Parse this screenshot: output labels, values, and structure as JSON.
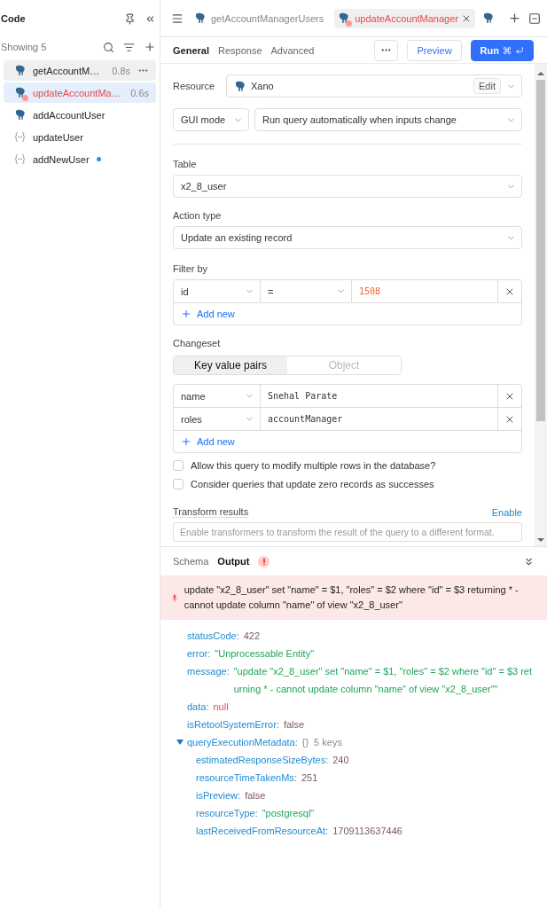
{
  "sidebar": {
    "title": "Code",
    "count_label": "Showing 5",
    "items": [
      {
        "name": "getAccountM…",
        "time": "0.8s",
        "kind": "resource",
        "selected": false,
        "hovered": true,
        "error": false,
        "unsaved": false
      },
      {
        "name": "updateAccountMa…",
        "time": "0.6s",
        "kind": "resource",
        "selected": true,
        "hovered": false,
        "error": true,
        "unsaved": false
      },
      {
        "name": "addAccountUser",
        "kind": "resource",
        "selected": false,
        "hovered": false,
        "error": false,
        "unsaved": false
      },
      {
        "name": "updateUser",
        "kind": "script",
        "selected": false,
        "hovered": false,
        "error": false,
        "unsaved": false
      },
      {
        "name": "addNewUser",
        "kind": "script",
        "selected": false,
        "hovered": false,
        "error": false,
        "unsaved": true
      }
    ]
  },
  "tabs": [
    {
      "label": "getAccountManagerUsers",
      "selected": false,
      "error": false
    },
    {
      "label": "updateAccountManager",
      "selected": true,
      "error": true
    }
  ],
  "subtabs": [
    {
      "label": "General",
      "selected": true
    },
    {
      "label": "Response",
      "selected": false
    },
    {
      "label": "Advanced",
      "selected": false
    }
  ],
  "actions": {
    "preview": "Preview",
    "run": "Run"
  },
  "form": {
    "resource": {
      "label": "Resource",
      "value": "Xano",
      "edit": "Edit"
    },
    "mode": "GUI mode",
    "trigger": "Run query automatically when inputs change",
    "table": {
      "label": "Table",
      "value": "x2_8_user"
    },
    "action_type": {
      "label": "Action type",
      "value": "Update an existing record"
    },
    "filter": {
      "label": "Filter by",
      "rows": [
        {
          "column": "id",
          "operator": "=",
          "value": "1508"
        }
      ],
      "add": "Add new"
    },
    "changeset": {
      "label": "Changeset",
      "modes": [
        {
          "label": "Key value pairs",
          "selected": true
        },
        {
          "label": "Object",
          "selected": false
        }
      ],
      "rows": [
        {
          "key": "name",
          "value": "Snehal Parate"
        },
        {
          "key": "roles",
          "value": "accountManager"
        }
      ],
      "add": "Add new"
    },
    "options": [
      {
        "label": "Allow this query to modify multiple rows in the database?",
        "checked": false
      },
      {
        "label": "Consider queries that update zero records as successes",
        "checked": false
      }
    ],
    "transform": {
      "label": "Transform results",
      "action": "Enable",
      "placeholder": "Enable transformers to transform the result of the query to a different format."
    }
  },
  "output": {
    "tabs": [
      {
        "label": "Schema",
        "selected": false,
        "error": false
      },
      {
        "label": "Output",
        "selected": true,
        "error": true
      }
    ],
    "error_message": "update \"x2_8_user\" set \"name\" = $1, \"roles\" = $2 where \"id\" = $3 returning * - cannot update column \"name\" of view \"x2_8_user\"",
    "tree": [
      {
        "key": "statusCode:",
        "value": "422",
        "kind": "number"
      },
      {
        "key": "error:",
        "value": "\"Unprocessable Entity\"",
        "kind": "string"
      },
      {
        "key": "message:",
        "value": "\"update \"x2_8_user\" set \"name\" = $1, \"roles\" = $2 where \"id\" = $3 returning * - cannot update column \"name\" of view \"x2_8_user\"\"",
        "kind": "string"
      },
      {
        "key": "data:",
        "value": "null",
        "kind": "null"
      },
      {
        "key": "isRetoolSystemError:",
        "value": "false",
        "kind": "boolean"
      },
      {
        "key": "queryExecutionMetadata:",
        "value": "{}",
        "count": "5 keys",
        "kind": "object",
        "expanded": true,
        "children": [
          {
            "key": "estimatedResponseSizeBytes:",
            "value": "240",
            "kind": "number"
          },
          {
            "key": "resourceTimeTakenMs:",
            "value": "251",
            "kind": "number"
          },
          {
            "key": "isPreview:",
            "value": "false",
            "kind": "boolean"
          },
          {
            "key": "resourceType:",
            "value": "\"postgresql\"",
            "kind": "string"
          },
          {
            "key": "lastReceivedFromResourceAt:",
            "value": "1709113637446",
            "kind": "number"
          }
        ]
      }
    ]
  }
}
